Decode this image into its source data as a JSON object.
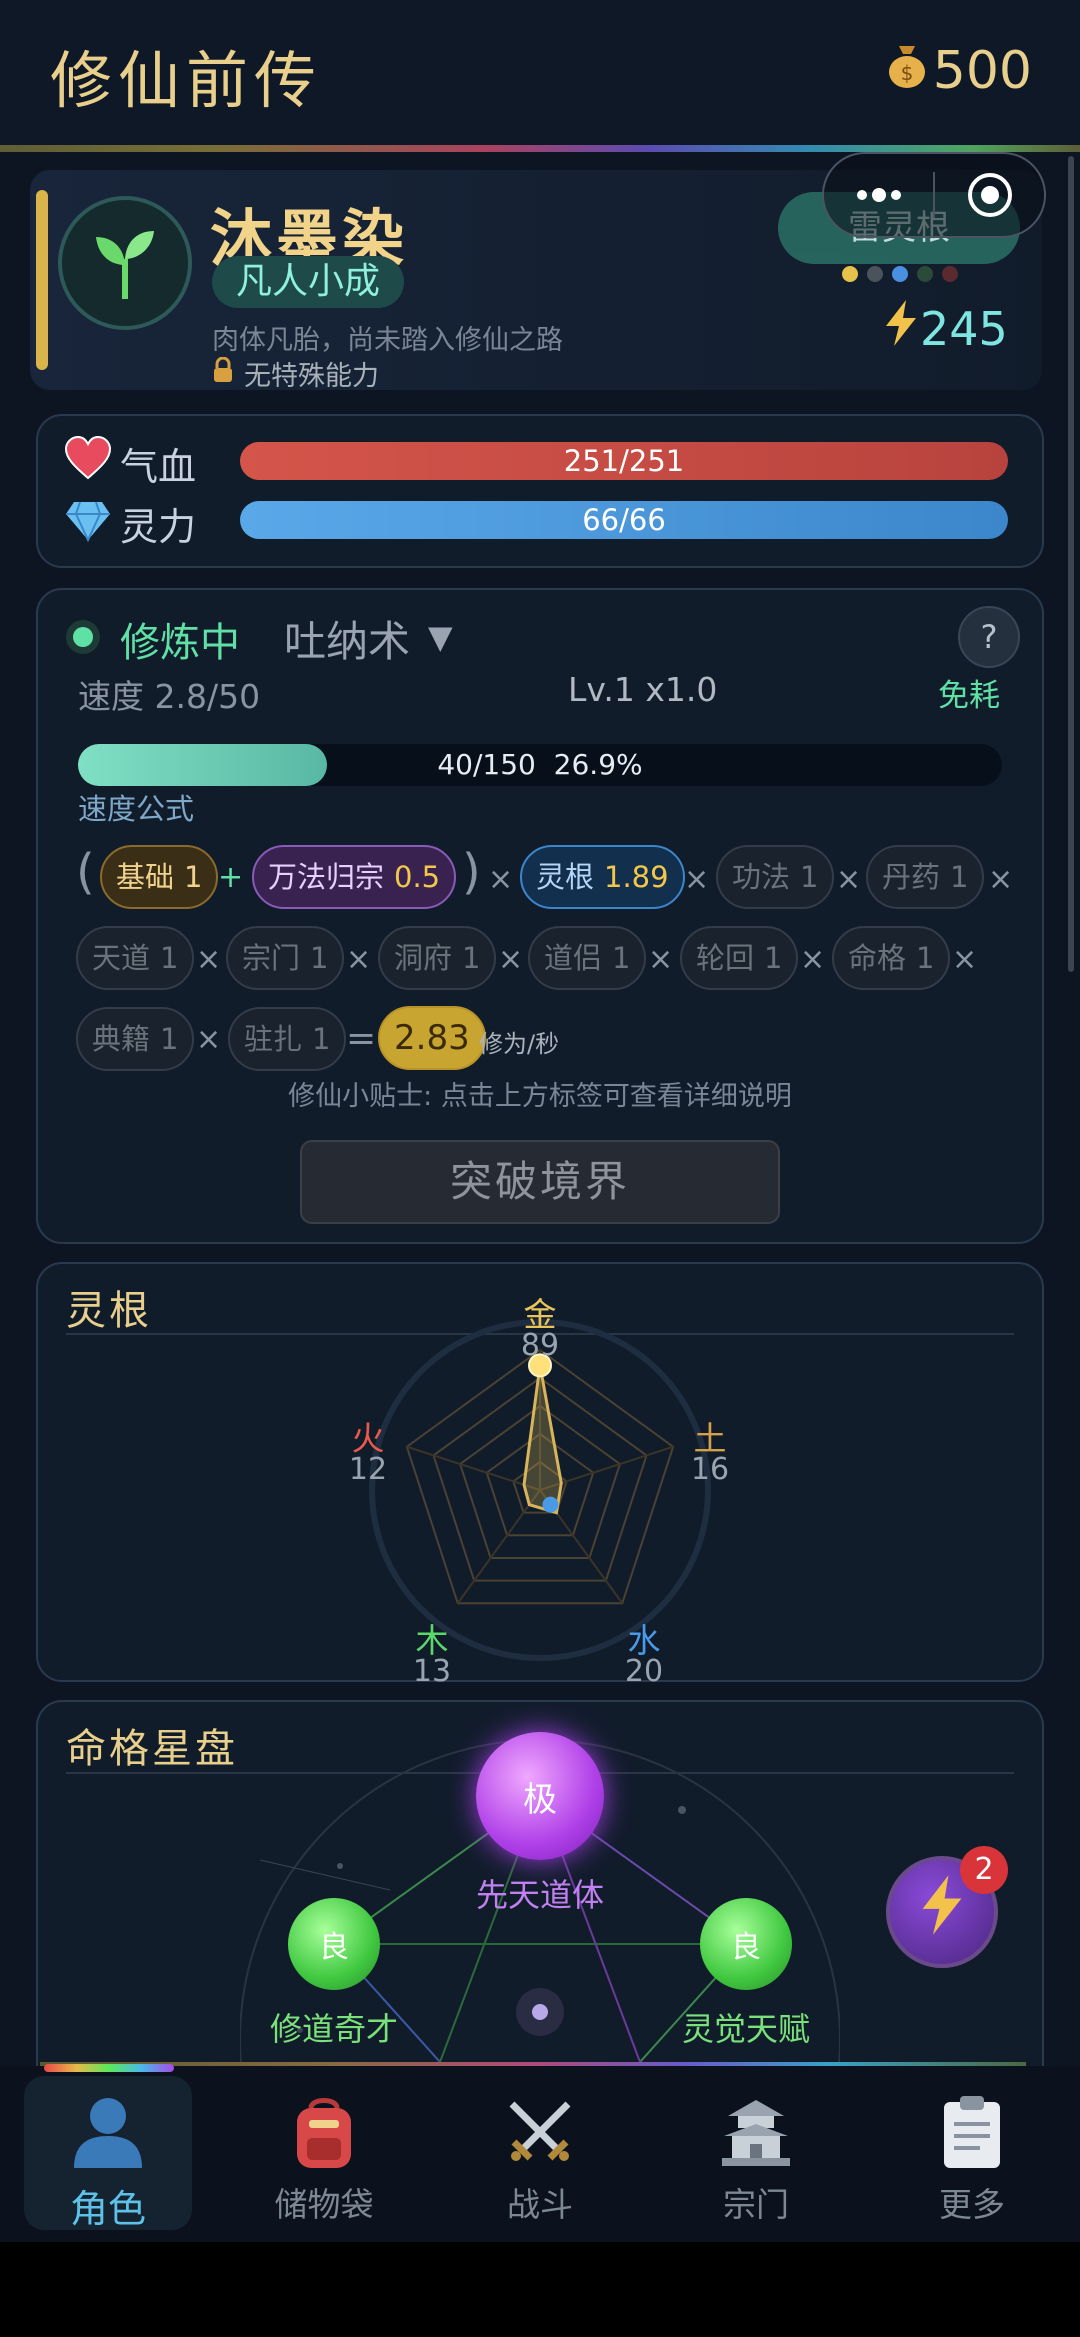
{
  "header": {
    "title": "修仙前传",
    "gold": "500",
    "gold_icon": "money-bag-icon"
  },
  "profile": {
    "name": "沐墨染",
    "realm": "凡人小成",
    "description": "肉体凡胎，尚未踏入修仙之路",
    "ability": "无特殊能力",
    "spirit_root": "雷灵根",
    "root_dot_colors": [
      "#e6c24a",
      "#4a525c",
      "#4a90e2",
      "#2a4a3a",
      "#5a2a2e"
    ],
    "energy": "245"
  },
  "stats": {
    "hp_label": "气血",
    "hp_value": "251/251",
    "hp_fraction": 1.0,
    "mp_label": "灵力",
    "mp_value": "66/66",
    "mp_fraction": 1.0
  },
  "cultivation": {
    "status": "修炼中",
    "technique": "吐纳术",
    "help": "?",
    "speed": "速度 2.8/50",
    "level": "Lv.1 x1.0",
    "cost": "免耗",
    "progress_text": "40/150  26.9%",
    "progress_fraction": 0.269,
    "formula_label": "速度公式",
    "factors": {
      "base": {
        "label": "基础",
        "value": "1"
      },
      "wanfa": {
        "label": "万法归宗",
        "value": "0.5"
      },
      "root": {
        "label": "灵根",
        "value": "1.89"
      },
      "gongfa": {
        "label": "功法",
        "value": "1"
      },
      "danyao": {
        "label": "丹药",
        "value": "1"
      },
      "tiandao": {
        "label": "天道",
        "value": "1"
      },
      "zongmen": {
        "label": "宗门",
        "value": "1"
      },
      "dongfu": {
        "label": "洞府",
        "value": "1"
      },
      "daolv": {
        "label": "道侣",
        "value": "1"
      },
      "lunhui": {
        "label": "轮回",
        "value": "1"
      },
      "mingge": {
        "label": "命格",
        "value": "1"
      },
      "dianji": {
        "label": "典籍",
        "value": "1"
      },
      "zhuzha": {
        "label": "驻扎",
        "value": "1"
      }
    },
    "result": "2.83",
    "unit": "修为/秒",
    "tip": "修仙小贴士: 点击上方标签可查看详细说明",
    "breakthrough": "突破境界"
  },
  "roots": {
    "title": "灵根",
    "elements": [
      {
        "name": "金",
        "value": 89,
        "color": "#e8c45a"
      },
      {
        "name": "土",
        "value": 16,
        "color": "#d4a04a"
      },
      {
        "name": "水",
        "value": 20,
        "color": "#4a9ae8"
      },
      {
        "name": "木",
        "value": 13,
        "color": "#5ad86a"
      },
      {
        "name": "火",
        "value": 12,
        "color": "#e85a4a"
      }
    ]
  },
  "fate": {
    "title": "命格星盘",
    "top": {
      "grade": "极",
      "name": "先天道体"
    },
    "left": {
      "grade": "良",
      "name": "修道奇才"
    },
    "right": {
      "grade": "良",
      "name": "灵觉天赋"
    },
    "badge": "2"
  },
  "nav": [
    {
      "label": "角色",
      "icon": "person-icon"
    },
    {
      "label": "储物袋",
      "icon": "backpack-icon"
    },
    {
      "label": "战斗",
      "icon": "crossed-swords-icon"
    },
    {
      "label": "宗门",
      "icon": "temple-icon"
    },
    {
      "label": "更多",
      "icon": "clipboard-icon"
    }
  ]
}
